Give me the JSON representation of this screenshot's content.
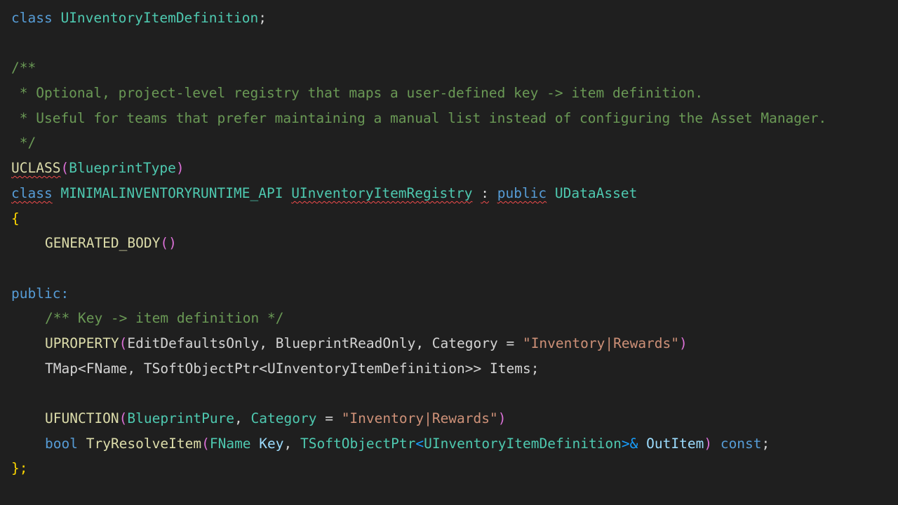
{
  "code": {
    "l1": {
      "kw": "class",
      "name": "UInventoryItemDefinition",
      "semi": ";"
    },
    "l3": "/**",
    "l4": " * Optional, project-level registry that maps a user-defined key -> item definition.",
    "l5": " * Useful for teams that prefer maintaining a manual list instead of configuring the Asset Manager.",
    "l6": " */",
    "l7": {
      "macro": "UCLASS",
      "open": "(",
      "arg": "BlueprintType",
      "close": ")"
    },
    "l8": {
      "kw": "class",
      "api": "MINIMALINVENTORYRUNTIME_API",
      "name": "UInventoryItemRegistry",
      "colon": ":",
      "access": "public",
      "base": "UDataAsset"
    },
    "l9": "{",
    "l10": {
      "macro": "GENERATED_BODY",
      "parens": "()"
    },
    "l12": "public:",
    "l13": "/** Key -> item definition */",
    "l14": {
      "macro": "UPROPERTY",
      "open": "(",
      "args": "EditDefaultsOnly, BlueprintReadOnly, Category = ",
      "str": "\"Inventory|Rewards\"",
      "close": ")"
    },
    "l15": {
      "type": "TMap",
      "lt": "<",
      "t1": "FName, ",
      "t2": "TSoftObjectPtr",
      "lt2": "<",
      "t3": "UInventoryItemDefinition",
      "gt": ">> ",
      "field": "Items",
      "semi": ";"
    },
    "l17": {
      "macro": "UFUNCTION",
      "open": "(",
      "arg1": "BlueprintPure",
      "sep": ", ",
      "arg2": "Category",
      "eq": " = ",
      "str": "\"Inventory|Rewards\"",
      "close": ")"
    },
    "l18": {
      "ret": "bool",
      "fn": "TryResolveItem",
      "open": "(",
      "p1t": "FName",
      "p1": "Key",
      "sep": ", ",
      "p2t": "TSoftObjectPtr",
      "lt": "<",
      "p2tt": "UInventoryItemDefinition",
      "gt": ">&",
      "p2": "OutItem",
      "close": ")",
      "cst": "const",
      "semi": ";"
    },
    "l19": "};"
  }
}
